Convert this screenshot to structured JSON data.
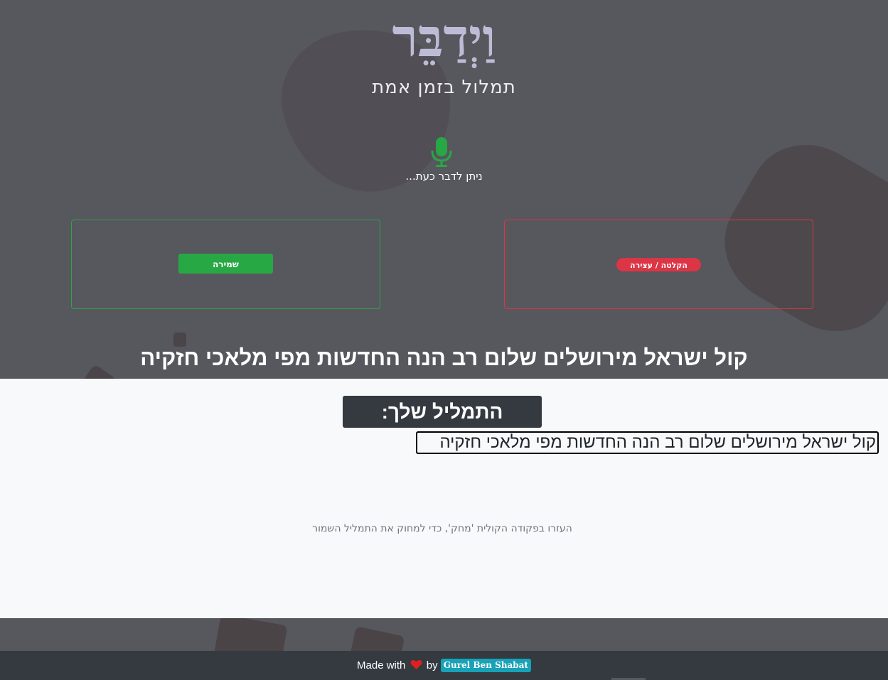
{
  "header": {
    "logo": "וַיְדַבֵּר",
    "subtitle": "תמלול בזמן אמת",
    "status": "ניתן לדבר כעת..."
  },
  "controls": {
    "save_label": "שמירה",
    "record_label": "הקלטה / עצירה"
  },
  "live_transcript": "קול ישראל מירושלים שלום רב הנה החדשות מפי מלאכי חזקיה",
  "transcript": {
    "title": "התמליל שלך:",
    "text": "קול ישראל מירושלים שלום רב הנה החדשות מפי מלאכי חזקיה"
  },
  "hint": "העזרו בפקודה הקולית 'מחק', כדי למחוק את התמליל השמור",
  "footer": {
    "made_with": "Made with",
    "by": "by",
    "author": "Gurel Ben Shabat"
  },
  "colors": {
    "background": "#57575e",
    "save_green": "#28a745",
    "record_red": "#dc3545",
    "mic_green": "#28a745",
    "dark": "#343a40",
    "badge": "#17a2b8",
    "heart": "#e02020"
  },
  "icons": {
    "mic": "microphone-icon",
    "heart": "heart-icon"
  }
}
